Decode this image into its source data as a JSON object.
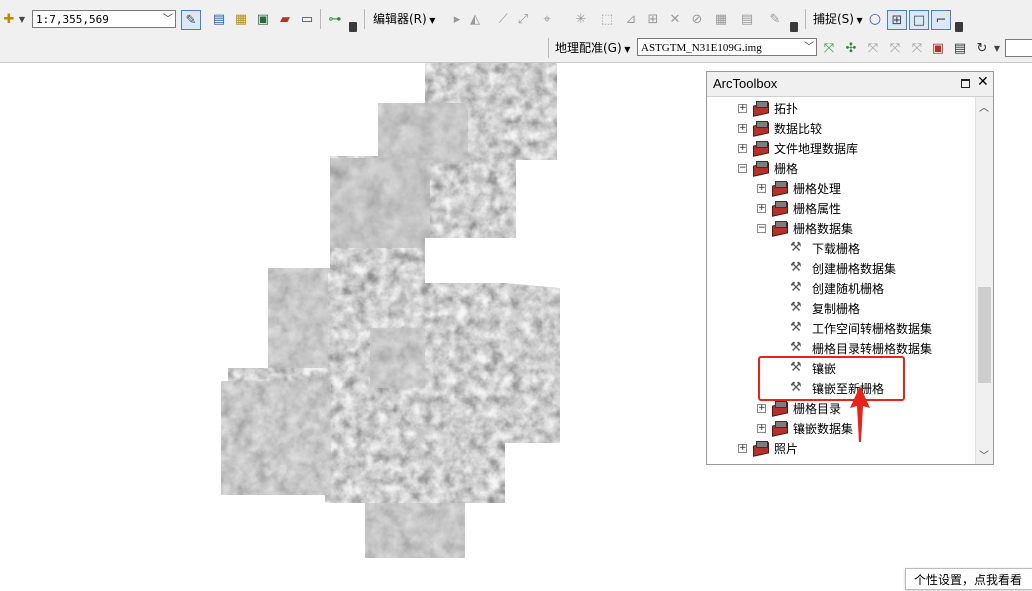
{
  "toolbar1": {
    "scale_value": "1:7,355,569",
    "editor_menu": "编辑器(R)",
    "snapping_menu": "捕捉(S)"
  },
  "toolbar2": {
    "georeferencing_menu": "地理配准(G)",
    "layer_select": "ASTGTM_N31E109G.img"
  },
  "arctoolbox": {
    "title": "ArcToolbox",
    "items": [
      {
        "label": "拓扑",
        "type": "toolbox",
        "expander": "+"
      },
      {
        "label": "数据比较",
        "type": "toolbox",
        "expander": "+"
      },
      {
        "label": "文件地理数据库",
        "type": "toolbox",
        "expander": "+"
      },
      {
        "label": "栅格",
        "type": "toolbox",
        "expander": "−"
      },
      {
        "label": "栅格处理",
        "type": "toolset",
        "expander": "+"
      },
      {
        "label": "栅格属性",
        "type": "toolset",
        "expander": "+"
      },
      {
        "label": "栅格数据集",
        "type": "toolset",
        "expander": "−"
      },
      {
        "label": "下载栅格",
        "type": "tool"
      },
      {
        "label": "创建栅格数据集",
        "type": "tool"
      },
      {
        "label": "创建随机栅格",
        "type": "tool"
      },
      {
        "label": "复制栅格",
        "type": "tool"
      },
      {
        "label": "工作空间转栅格数据集",
        "type": "tool"
      },
      {
        "label": "栅格目录转栅格数据集",
        "type": "tool"
      },
      {
        "label": "镶嵌",
        "type": "tool"
      },
      {
        "label": "镶嵌至新栅格",
        "type": "tool"
      },
      {
        "label": "栅格目录",
        "type": "toolset",
        "expander": "+"
      },
      {
        "label": "镶嵌数据集",
        "type": "toolset",
        "expander": "+"
      },
      {
        "label": "照片",
        "type": "toolbox",
        "expander": "+"
      }
    ]
  },
  "annotation": {
    "highlight_color": "#e8231a"
  },
  "tooltip": {
    "text": "个性设置，点我看看"
  },
  "icons": [
    "add-data-icon",
    "editor-icons",
    "snapping-icons",
    "georef-icons",
    "toolbox-icon",
    "hammer-tool-icon"
  ]
}
